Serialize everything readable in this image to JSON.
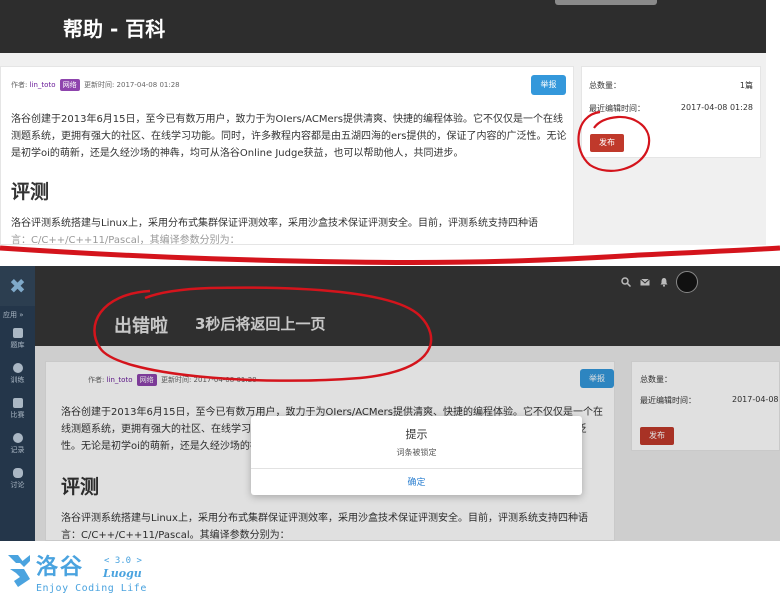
{
  "top": {
    "header_title": "帮助 - 百科",
    "meta_author_label": "作者:",
    "meta_author": "lin_toto",
    "meta_badge": "网络",
    "meta_time": "更新时间: 2017-04-08 01:28",
    "report_label": "举报",
    "intro": "洛谷创建于2013年6月15日，至今已有数万用户，致力于为OIers/ACMers提供清爽、快捷的编程体验。它不仅仅是一个在线测题系统，更拥有强大的社区、在线学习功能。同时，许多教程内容都是由五湖四海的ers提供的，保证了内容的广泛性。无论是初学oi的萌新，还是久经沙场的神犇，均可从洛谷Online Judge获益，也可以帮助他人，共同进步。",
    "section_heading": "评测",
    "section_text": "洛谷评测系统搭建与Linux上，采用分布式集群保证评测效率，采用沙盒技术保证评测安全。目前，评测系统支持四种语",
    "section_text_cut": "言：C/C++/C++11/Pascal，其编译参数分别为：",
    "total_label": "总数量：",
    "total_value": "1篇",
    "last_edit_label": "最近编辑时间：",
    "last_edit_value": "2017-04-08 01:28",
    "publish_label": "发布"
  },
  "bottom": {
    "sidebar": {
      "apps_toggle": "应用 »",
      "items": [
        {
          "label": "题库"
        },
        {
          "label": "训练"
        },
        {
          "label": "比赛"
        },
        {
          "label": "记录"
        },
        {
          "label": "讨论"
        }
      ]
    },
    "error_title": "出错啦",
    "error_subtitle": "3秒后将返回上一页",
    "meta_author_label": "作者:",
    "meta_author": "lin_toto",
    "meta_badge": "网络",
    "meta_time": "更新时间: 2017-04-08 01:28",
    "report_label": "举报",
    "intro": "洛谷创建于2013年6月15日，至今已有数万用户，致力于为OIers/ACMers提供清爽、快捷的编程体验。它不仅仅是一个在线测题系统，更拥有强大的社区、在线学习功能。同时，许多教程内容都是由五湖四海的ers提供的，保证了内容的广泛性。无论是初学oi的萌新，还是久经沙场的神犇，均可从洛谷Online Judge获益，也可以帮助他人，共同进步。",
    "section_heading": "评测",
    "section_text": "洛谷评测系统搭建与Linux上，采用分布式集群保证评测效率，采用沙盒技术保证评测安全。目前，评测系统支持四种语言：C/C++/C++11/Pascal。其编译参数分别为：",
    "total_label": "总数量：",
    "last_edit_label": "最近编辑时间：",
    "last_edit_value": "2017-04-08",
    "publish_label": "发布",
    "modal": {
      "title": "提示",
      "message": "词条被锁定",
      "ok_label": "确定"
    }
  },
  "footer": {
    "logo_cn": "洛谷",
    "version": "< 3.0 >",
    "logo_en": "Luogu",
    "slogan": "Enjoy Coding Life"
  },
  "colors": {
    "header_dark": "#2d2d2d",
    "report_blue": "#3498db",
    "publish_red": "#c0392b",
    "badge_purple": "#8e44ad",
    "sidebar_navy": "#24364a",
    "annotation_red": "#d4141c",
    "brand_blue": "#4aa3df"
  },
  "icons": [
    "search-icon",
    "mail-icon",
    "bell-icon",
    "avatar",
    "luogu-logo-icon"
  ]
}
